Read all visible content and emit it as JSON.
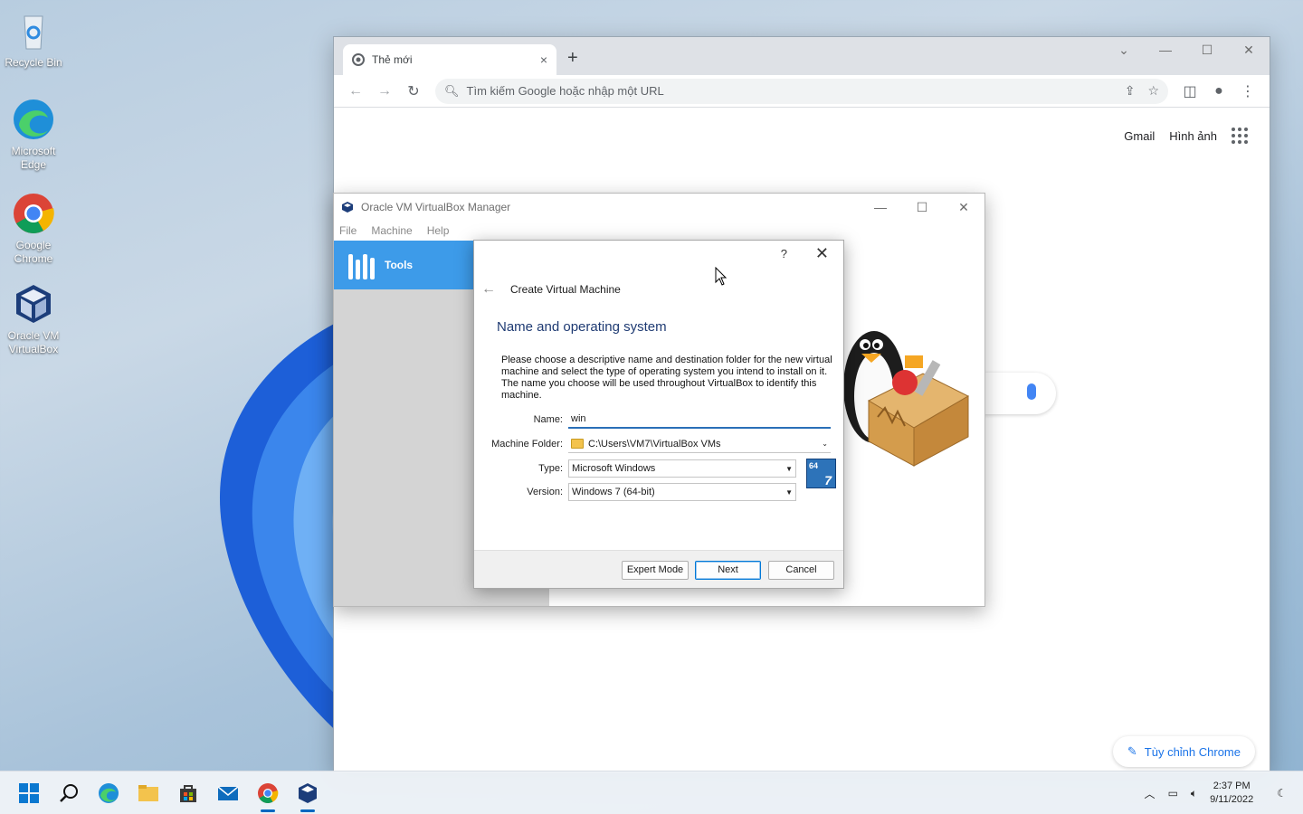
{
  "desktop": {
    "icons": [
      {
        "label": "Recycle Bin"
      },
      {
        "label": "Microsoft Edge"
      },
      {
        "label": "Google Chrome"
      },
      {
        "label": "Oracle VM VirtualBox"
      }
    ]
  },
  "chrome": {
    "tab_title": "Thẻ mới",
    "tab_close": "×",
    "new_tab": "+",
    "omnibox_placeholder": "Tìm kiếm Google hoặc nhập một URL",
    "links": {
      "gmail": "Gmail",
      "images": "Hình ảnh"
    },
    "customize_label": "Tùy chỉnh Chrome"
  },
  "vbox": {
    "title": "Oracle VM VirtualBox Manager",
    "menu": [
      "File",
      "Machine",
      "Help"
    ],
    "tools_label": "Tools"
  },
  "dialog": {
    "help": "?",
    "close": "✕",
    "header": "Create Virtual Machine",
    "section_title": "Name and operating system",
    "description": "Please choose a descriptive name and destination folder for the new virtual machine and select the type of operating system you intend to install on it. The name you choose will be used throughout VirtualBox to identify this machine.",
    "name": {
      "label": "Name:",
      "value": "win"
    },
    "folder": {
      "label": "Machine Folder:",
      "value": "C:\\Users\\VM7\\VirtualBox VMs"
    },
    "type": {
      "label": "Type:",
      "value": "Microsoft Windows"
    },
    "version": {
      "label": "Version:",
      "value": "Windows 7 (64-bit)"
    },
    "os_badge": {
      "top": "64",
      "big": "7"
    },
    "buttons": {
      "expert": "Expert Mode",
      "next": "Next",
      "cancel": "Cancel"
    }
  },
  "taskbar": {
    "time": "2:37 PM",
    "date": "9/11/2022"
  },
  "colors": {
    "accent": "#3d9be9",
    "title_blue": "#1f3b73",
    "chrome_blue": "#1a73e8"
  }
}
